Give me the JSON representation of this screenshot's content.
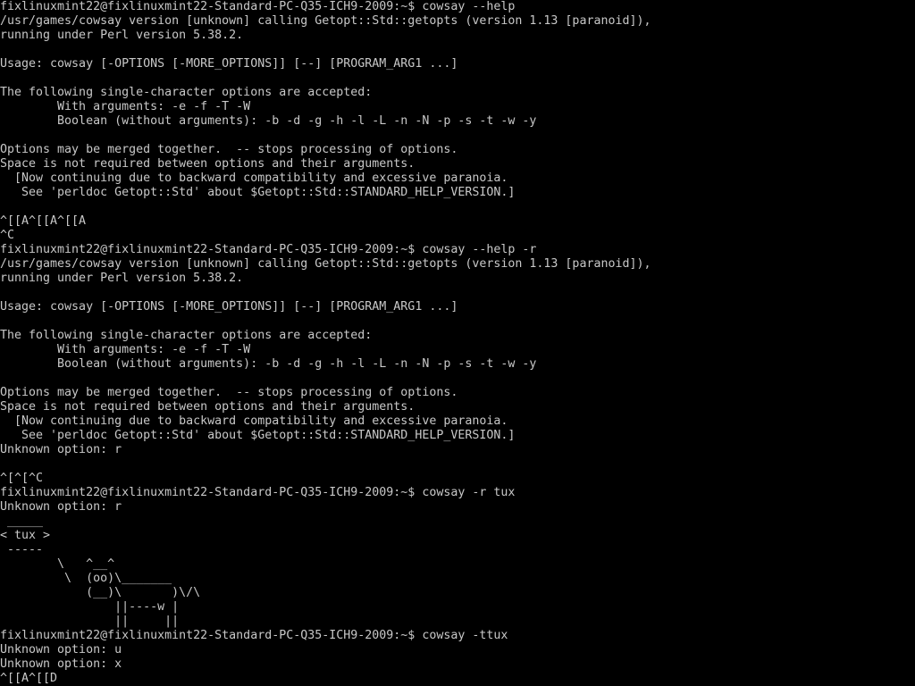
{
  "terminal": {
    "lines": [
      "fixlinuxmint22@fixlinuxmint22-Standard-PC-Q35-ICH9-2009:~$ cowsay --help",
      "/usr/games/cowsay version [unknown] calling Getopt::Std::getopts (version 1.13 [paranoid]),",
      "running under Perl version 5.38.2.",
      "",
      "Usage: cowsay [-OPTIONS [-MORE_OPTIONS]] [--] [PROGRAM_ARG1 ...]",
      "",
      "The following single-character options are accepted:",
      "        With arguments: -e -f -T -W",
      "        Boolean (without arguments): -b -d -g -h -l -L -n -N -p -s -t -w -y",
      "",
      "Options may be merged together.  -- stops processing of options.",
      "Space is not required between options and their arguments.",
      "  [Now continuing due to backward compatibility and excessive paranoia.",
      "   See 'perldoc Getopt::Std' about $Getopt::Std::STANDARD_HELP_VERSION.]",
      "",
      "^[[A^[[A^[[A",
      "^C",
      "fixlinuxmint22@fixlinuxmint22-Standard-PC-Q35-ICH9-2009:~$ cowsay --help -r",
      "/usr/games/cowsay version [unknown] calling Getopt::Std::getopts (version 1.13 [paranoid]),",
      "running under Perl version 5.38.2.",
      "",
      "Usage: cowsay [-OPTIONS [-MORE_OPTIONS]] [--] [PROGRAM_ARG1 ...]",
      "",
      "The following single-character options are accepted:",
      "        With arguments: -e -f -T -W",
      "        Boolean (without arguments): -b -d -g -h -l -L -n -N -p -s -t -w -y",
      "",
      "Options may be merged together.  -- stops processing of options.",
      "Space is not required between options and their arguments.",
      "  [Now continuing due to backward compatibility and excessive paranoia.",
      "   See 'perldoc Getopt::Std' about $Getopt::Std::STANDARD_HELP_VERSION.]",
      "Unknown option: r",
      "",
      "^[^[^C",
      "fixlinuxmint22@fixlinuxmint22-Standard-PC-Q35-ICH9-2009:~$ cowsay -r tux",
      "Unknown option: r",
      " _____",
      "< tux >",
      " -----",
      "        \\   ^__^",
      "         \\  (oo)\\_______",
      "            (__)\\       )\\/\\",
      "                ||----w |",
      "                ||     ||",
      "fixlinuxmint22@fixlinuxmint22-Standard-PC-Q35-ICH9-2009:~$ cowsay -ttux",
      "Unknown option: u",
      "Unknown option: x",
      "^[[A^[[D"
    ]
  }
}
